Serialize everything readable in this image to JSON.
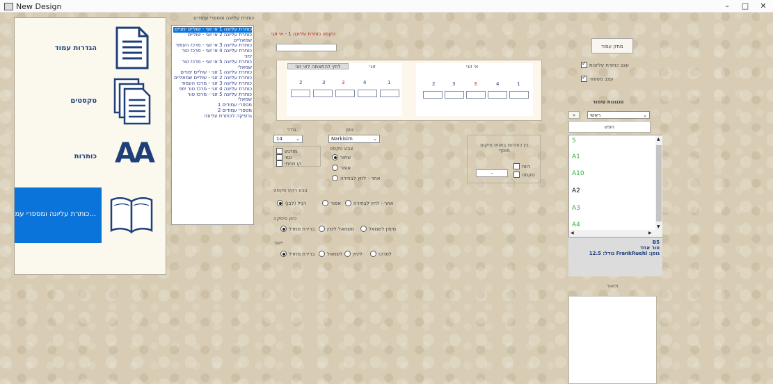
{
  "window": {
    "title": "New Design",
    "min": "–",
    "max": "□",
    "close": "✕"
  },
  "categories": [
    {
      "label": "הגדרות עמוד",
      "icon": "document-icon"
    },
    {
      "label": "טקסטים",
      "icon": "documents-icon"
    },
    {
      "label": "כותרות",
      "icon": "font-aa-icon",
      "icon_text": "AA"
    },
    {
      "label": "כותרת עליונה ומספרי עמ...",
      "icon": "open-book-icon",
      "active": true
    }
  ],
  "list": {
    "title": "כותרת עליונה ומספרי עמודים",
    "items": [
      "כותרת עליונה 1 אי זוגי - שוליים ימניים",
      "כותרת עליונה 2 אי זוגי - שוליים שמאליים",
      "כותרת עליונה 3 אי זוגי - מרכז העמוד",
      "כותרת עליונה 4 אי זוגי - מרכז טור ימני",
      "כותרת עליונה 5 אי זוגי - מרכז טור שמאלי",
      "כותרת עליונה 1 זוגי - שוליים ימניים",
      "כותרת עליונה 2 זוגי - שוליים שמאליים",
      "כותרת עליונה 3 זוגי - מרכז העמוד",
      "כותרת עליונה 4 זוגי - מרכז טור ימני",
      "כותרת עליונה 5 זוגי - מרכז טור שמאלי",
      "מספרי עמודים 1",
      "מספרי עמודים 2",
      "גרפיקה לכותרת עליונה"
    ]
  },
  "form": {
    "header_text_label": "טקסט כותרת עליונה 1 - אי זוגי",
    "header_text_value": "",
    "even_label": "זוגי",
    "odd_label": "אי זוגי",
    "copy_button": "לחץ להתאמה לאי זוגי",
    "even_numbers": [
      "2",
      "3",
      "3",
      "4",
      "1"
    ],
    "odd_numbers": [
      "2",
      "3",
      "3",
      "4",
      "1"
    ],
    "size_label": "גודל",
    "size_value": "14",
    "font_label": "גופן",
    "font_value": "Narkisim",
    "style_options": [
      "מודגש",
      "נטוי",
      "קו תחתי"
    ],
    "text_color_label": "צבע טקסט",
    "text_color_options": [
      "שחור",
      "אפור",
      "אחר - לחץ לבחירה"
    ],
    "spacing_label": "בין כותרות באותו מיקום",
    "spacing_label2": "מוסף",
    "spacing_value": "-",
    "spacing_options": [
      "רווח",
      "טקסט"
    ],
    "bg_color_label": "צבע רקע טקסט",
    "bg_color_options": [
      "רגיל (לבן)",
      "אפור",
      "אחר - לחץ לבחירה"
    ],
    "direction_label": "כיוון פיסקה",
    "direction_options": [
      "ברירת מחדל",
      "משמאל לימין",
      "מימין לשמאל"
    ],
    "align_label": "יישור",
    "align_options": [
      "ברירת מחדל",
      "לשמאל",
      "לימין",
      "למרכז"
    ]
  },
  "right_panel": {
    "delete_page_button": "מחק עמוד",
    "header_check_label": "עצב כותרת עליונות",
    "spacing_check_label": "עצב מספור",
    "styles_label": "סגנונות עימוד",
    "styles_select": "ראשי",
    "styles_select_prefix": "«",
    "search_button": "חפש",
    "styles": [
      {
        "text": "5",
        "color": "#2bb03b"
      },
      {
        "text": "A1",
        "color": "#2bb03b"
      },
      {
        "text": "A10",
        "color": "#2bb03b"
      },
      {
        "text": "A2",
        "color": "#111111"
      },
      {
        "text": "A3",
        "color": "#2bb03b"
      },
      {
        "text": "A4",
        "color": "#2bb03b"
      }
    ],
    "info_line1": "B5",
    "info_line2": "טור אחד",
    "info_line3": "גופן: FrankRuehl גודל: 12.5",
    "description_label": "תיאור"
  }
}
